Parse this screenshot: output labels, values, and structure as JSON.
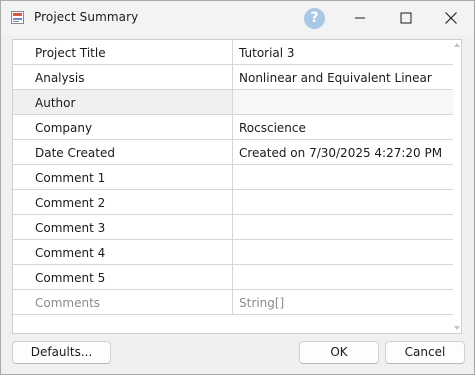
{
  "window": {
    "title": "Project Summary"
  },
  "icons": {
    "app": "project-summary-app-icon",
    "help": "help-icon",
    "minimize": "minimize-icon",
    "maximize": "maximize-icon",
    "close": "close-icon"
  },
  "help_glyph": "?",
  "grid": {
    "rows": [
      {
        "label": "Project Title",
        "value": "Tutorial 3"
      },
      {
        "label": "Analysis",
        "value": "Nonlinear and Equivalent Linear"
      },
      {
        "label": "Author",
        "value": ""
      },
      {
        "label": "Company",
        "value": "Rocscience"
      },
      {
        "label": "Date Created",
        "value": "Created on 7/30/2025 4:27:20 PM"
      },
      {
        "label": "Comment 1",
        "value": ""
      },
      {
        "label": "Comment 2",
        "value": ""
      },
      {
        "label": "Comment 3",
        "value": ""
      },
      {
        "label": "Comment 4",
        "value": ""
      },
      {
        "label": "Comment 5",
        "value": ""
      },
      {
        "label": "Comments",
        "value": "String[]"
      }
    ],
    "selected_row": "Author"
  },
  "buttons": {
    "defaults": "Defaults...",
    "ok": "OK",
    "cancel": "Cancel"
  },
  "colors": {
    "selected_row_bg": "#f0f0f0",
    "help_icon_bg": "#a8c8e3",
    "readonly_text": "#8c8c8c"
  }
}
